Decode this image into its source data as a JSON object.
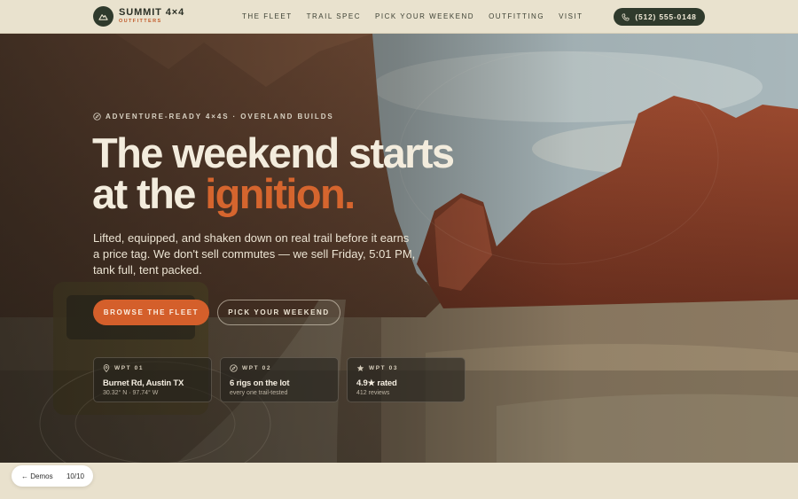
{
  "brand": {
    "name": "SUMMIT 4×4",
    "tagline": "OUTFITTERS",
    "logo_icon": "mountain-icon"
  },
  "nav": {
    "items": [
      {
        "label": "THE FLEET"
      },
      {
        "label": "TRAIL SPEC"
      },
      {
        "label": "PICK YOUR WEEKEND"
      },
      {
        "label": "OUTFITTING"
      },
      {
        "label": "VISIT"
      }
    ],
    "phone": "(512) 555-0148",
    "phone_icon": "phone-icon"
  },
  "hero": {
    "eyebrow": "ADVENTURE-READY 4×4S · OVERLAND BUILDS",
    "eyebrow_icon": "compass-icon",
    "headline_line1": "The weekend starts",
    "headline_line2_plain": "at the ",
    "headline_line2_accent": "ignition.",
    "lede_part1": "Lifted, equipped, and shaken down on real trail before it earns a price tag. ",
    "lede_part2": "We don't sell commutes — we sell Friday, 5:01 PM, tank full, tent packed.",
    "primary_cta": "BROWSE THE FLEET",
    "secondary_cta": "PICK YOUR WEEKEND"
  },
  "stats": [
    {
      "key": "WPT 01",
      "icon": "pin-icon",
      "value": "Burnet Rd, Austin TX",
      "sub": "30.32° N · 97.74° W"
    },
    {
      "key": "WPT 02",
      "icon": "compass-icon",
      "value": "6 rigs on the lot",
      "sub": "every one trail-tested"
    },
    {
      "key": "WPT 03",
      "icon": "star-icon",
      "value": "4.9★ rated",
      "sub": "412 reviews"
    }
  ],
  "demo": {
    "back_label": "← Demos",
    "counter": "10/10"
  },
  "colors": {
    "accent": "#d45f2b",
    "dark_green": "#2f3a2c",
    "cream": "#e9e2ce"
  }
}
